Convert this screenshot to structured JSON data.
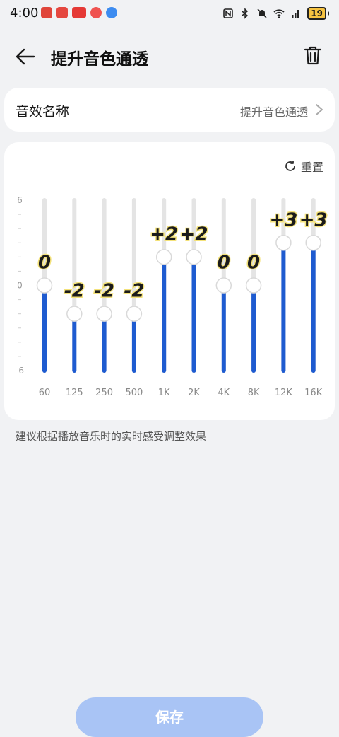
{
  "status": {
    "time": "4:00",
    "battery": "19"
  },
  "header": {
    "title": "提升音色通透"
  },
  "name_row": {
    "label": "音效名称",
    "value": "提升音色通透"
  },
  "eq": {
    "reset_label": "重置",
    "y_labels": [
      "6",
      "0",
      "-6"
    ],
    "accent": "#1e5bd0",
    "track": "#e4e4e4",
    "ymin": -6,
    "ymax": 6
  },
  "chart_data": {
    "type": "bar",
    "categories": [
      "60",
      "125",
      "250",
      "500",
      "1K",
      "2K",
      "4K",
      "8K",
      "12K",
      "16K"
    ],
    "values": [
      0,
      -2,
      -2,
      -2,
      2,
      2,
      0,
      0,
      3,
      3
    ],
    "value_labels": [
      "0",
      "-2",
      "-2",
      "-2",
      "+2",
      "+2",
      "0",
      "0",
      "+3",
      "+3"
    ],
    "ylim": [
      -6,
      6
    ]
  },
  "hint": "建议根据播放音乐时的实时感受调整效果",
  "save_label": "保存",
  "icons": {
    "back": "arrow-left-icon",
    "delete": "trash-icon",
    "reset": "refresh-icon",
    "chevron": "chevron-right-icon"
  }
}
